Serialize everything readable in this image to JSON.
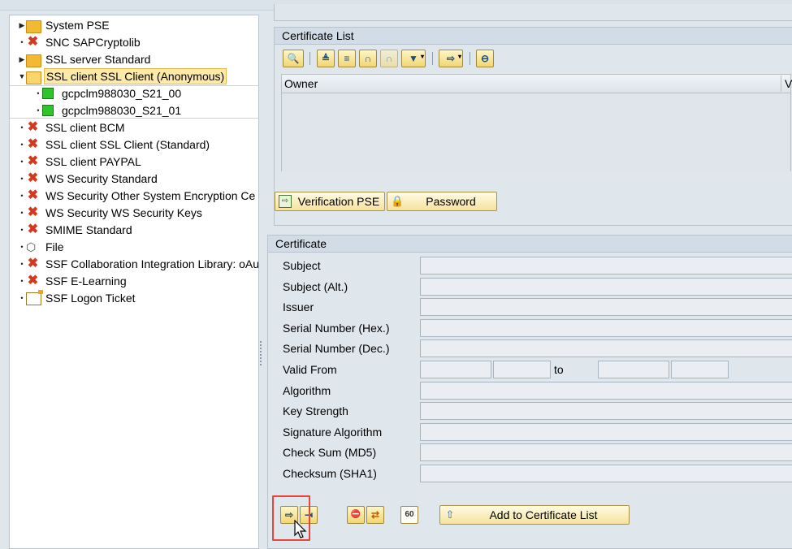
{
  "tree": {
    "items": [
      {
        "label": "System PSE",
        "expander": "▶",
        "icon": "folder-icon",
        "level": 0
      },
      {
        "label": "SNC SAPCryptolib",
        "expander": "•",
        "icon": "x-icon",
        "level": 0
      },
      {
        "label": "SSL server Standard",
        "expander": "▶",
        "icon": "folder-icon",
        "level": 0
      },
      {
        "label": "SSL client SSL Client (Anonymous)",
        "expander": "▼",
        "icon": "folder-open-icon",
        "level": 0,
        "selected": true
      },
      {
        "label": "gcpclm988030_S21_00",
        "expander": "•",
        "icon": "green-square-icon",
        "level": 1
      },
      {
        "label": "gcpclm988030_S21_01",
        "expander": "•",
        "icon": "green-square-icon",
        "level": 1
      },
      {
        "label": "SSL client BCM",
        "expander": "•",
        "icon": "x-icon",
        "level": 0
      },
      {
        "label": "SSL client SSL Client (Standard)",
        "expander": "•",
        "icon": "x-icon",
        "level": 0
      },
      {
        "label": "SSL client PAYPAL",
        "expander": "•",
        "icon": "x-icon",
        "level": 0
      },
      {
        "label": "WS Security Standard",
        "expander": "•",
        "icon": "x-icon",
        "level": 0
      },
      {
        "label": "WS Security Other System Encryption Ce",
        "expander": "•",
        "icon": "x-icon",
        "level": 0
      },
      {
        "label": "WS Security WS Security Keys",
        "expander": "•",
        "icon": "x-icon",
        "level": 0
      },
      {
        "label": "SMIME Standard",
        "expander": "•",
        "icon": "x-icon",
        "level": 0
      },
      {
        "label": "File",
        "expander": "•",
        "icon": "cube-icon",
        "level": 0
      },
      {
        "label": "SSF Collaboration Integration Library: oAu",
        "expander": "•",
        "icon": "x-icon",
        "level": 0
      },
      {
        "label": "SSF E-Learning",
        "expander": "•",
        "icon": "x-icon",
        "level": 0
      },
      {
        "label": "SSF Logon Ticket",
        "expander": "•",
        "icon": "ticket-icon",
        "level": 0
      }
    ]
  },
  "cert_list": {
    "title": "Certificate List",
    "col_owner": "Owner",
    "col_v": "V",
    "verification_pse": "Verification PSE",
    "password": "Password"
  },
  "certificate": {
    "title": "Certificate",
    "fields": [
      {
        "label": "Subject"
      },
      {
        "label": "Subject (Alt.)"
      },
      {
        "label": "Issuer"
      },
      {
        "label": "Serial Number (Hex.)"
      },
      {
        "label": "Serial Number (Dec.)"
      },
      {
        "label": "Valid From"
      },
      {
        "label": "Algorithm"
      },
      {
        "label": "Key Strength"
      },
      {
        "label": "Signature Algorithm"
      },
      {
        "label": "Check Sum (MD5)"
      },
      {
        "label": "Checksum (SHA1)"
      }
    ],
    "to_label": "to",
    "add_button": "Add to Certificate List"
  },
  "colors": {
    "highlight": "#e8453c",
    "selected_bg": "#fde9a8"
  }
}
